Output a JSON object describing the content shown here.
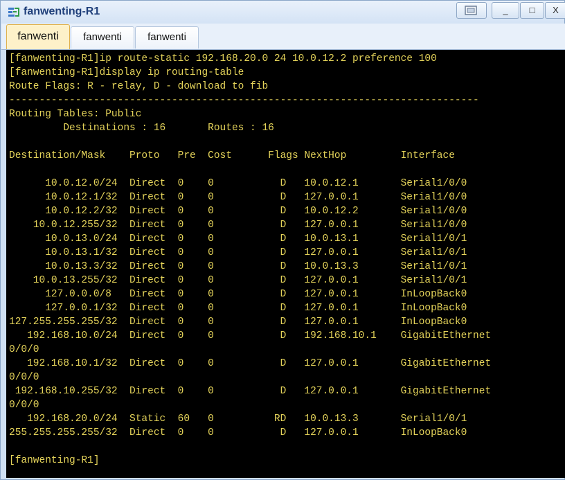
{
  "window": {
    "title": "fanwenting-R1",
    "icon": "router-network-icon",
    "controls": {
      "restore_icon": "restore-window-icon",
      "minimize": "_",
      "maximize": "□",
      "close": "X"
    }
  },
  "tabs": [
    {
      "label": "fanwenti",
      "active": true
    },
    {
      "label": "fanwenti",
      "active": false
    },
    {
      "label": "fanwenti",
      "active": false
    }
  ],
  "terminal": {
    "colors": {
      "background": "#000000",
      "text": "#e4d35a"
    },
    "lines": [
      "[fanwenting-R1]ip route-static 192.168.20.0 24 10.0.12.2 preference 100",
      "[fanwenting-R1]display ip routing-table",
      "Route Flags: R - relay, D - download to fib",
      "------------------------------------------------------------------------------",
      "Routing Tables: Public",
      "         Destinations : 16       Routes : 16",
      "",
      "Destination/Mask    Proto   Pre  Cost      Flags NextHop         Interface",
      "",
      "      10.0.12.0/24  Direct  0    0           D   10.0.12.1       Serial1/0/0",
      "      10.0.12.1/32  Direct  0    0           D   127.0.0.1       Serial1/0/0",
      "      10.0.12.2/32  Direct  0    0           D   10.0.12.2       Serial1/0/0",
      "    10.0.12.255/32  Direct  0    0           D   127.0.0.1       Serial1/0/0",
      "      10.0.13.0/24  Direct  0    0           D   10.0.13.1       Serial1/0/1",
      "      10.0.13.1/32  Direct  0    0           D   127.0.0.1       Serial1/0/1",
      "      10.0.13.3/32  Direct  0    0           D   10.0.13.3       Serial1/0/1",
      "    10.0.13.255/32  Direct  0    0           D   127.0.0.1       Serial1/0/1",
      "      127.0.0.0/8   Direct  0    0           D   127.0.0.1       InLoopBack0",
      "      127.0.0.1/32  Direct  0    0           D   127.0.0.1       InLoopBack0",
      "127.255.255.255/32  Direct  0    0           D   127.0.0.1       InLoopBack0",
      "   192.168.10.0/24  Direct  0    0           D   192.168.10.1    GigabitEthernet",
      "0/0/0",
      "   192.168.10.1/32  Direct  0    0           D   127.0.0.1       GigabitEthernet",
      "0/0/0",
      " 192.168.10.255/32  Direct  0    0           D   127.0.0.1       GigabitEthernet",
      "0/0/0",
      "   192.168.20.0/24  Static  60   0          RD   10.0.13.3       Serial1/0/1",
      "255.255.255.255/32  Direct  0    0           D   127.0.0.1       InLoopBack0",
      "",
      "[fanwenting-R1]"
    ]
  }
}
